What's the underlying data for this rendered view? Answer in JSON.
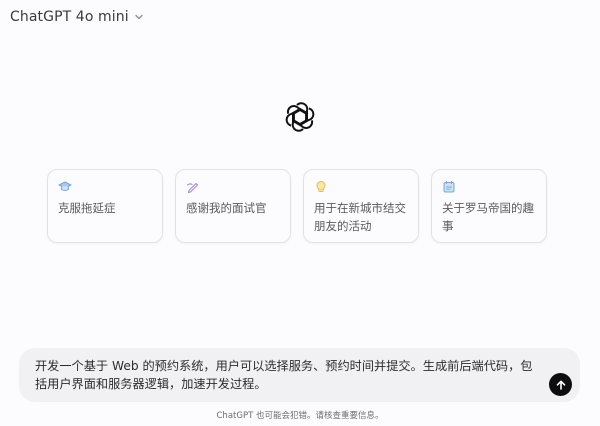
{
  "header": {
    "model_name": "ChatGPT 4o mini"
  },
  "logo": {
    "icon": "openai-logo-icon"
  },
  "suggestions": [
    {
      "icon": "graduation-cap-icon",
      "icon_color": "#76a8d6",
      "label": "克服拖延症"
    },
    {
      "icon": "pen-icon",
      "icon_color": "#a38ad0",
      "label": "感谢我的面试官"
    },
    {
      "icon": "lightbulb-icon",
      "icon_color": "#e0c15a",
      "label": "用于在新城市结交朋友的活动"
    },
    {
      "icon": "image-icon",
      "icon_color": "#76a8d6",
      "label": "关于罗马帝国的趣事"
    }
  ],
  "composer": {
    "text": "开发一个基于 Web 的预约系统，用户可以选择服务、预约时间并提交。生成前后端代码，包括用户界面和服务器逻辑，加速开发过程。",
    "send_icon": "arrow-up-icon"
  },
  "footer": {
    "disclaimer": "ChatGPT 也可能会犯错。请核查重要信息。"
  },
  "colors": {
    "background": "#fcfbfd",
    "composer_bg": "#f1f0f3",
    "send_button": "#0d0d0d",
    "card_border": "#e3e1e6"
  }
}
